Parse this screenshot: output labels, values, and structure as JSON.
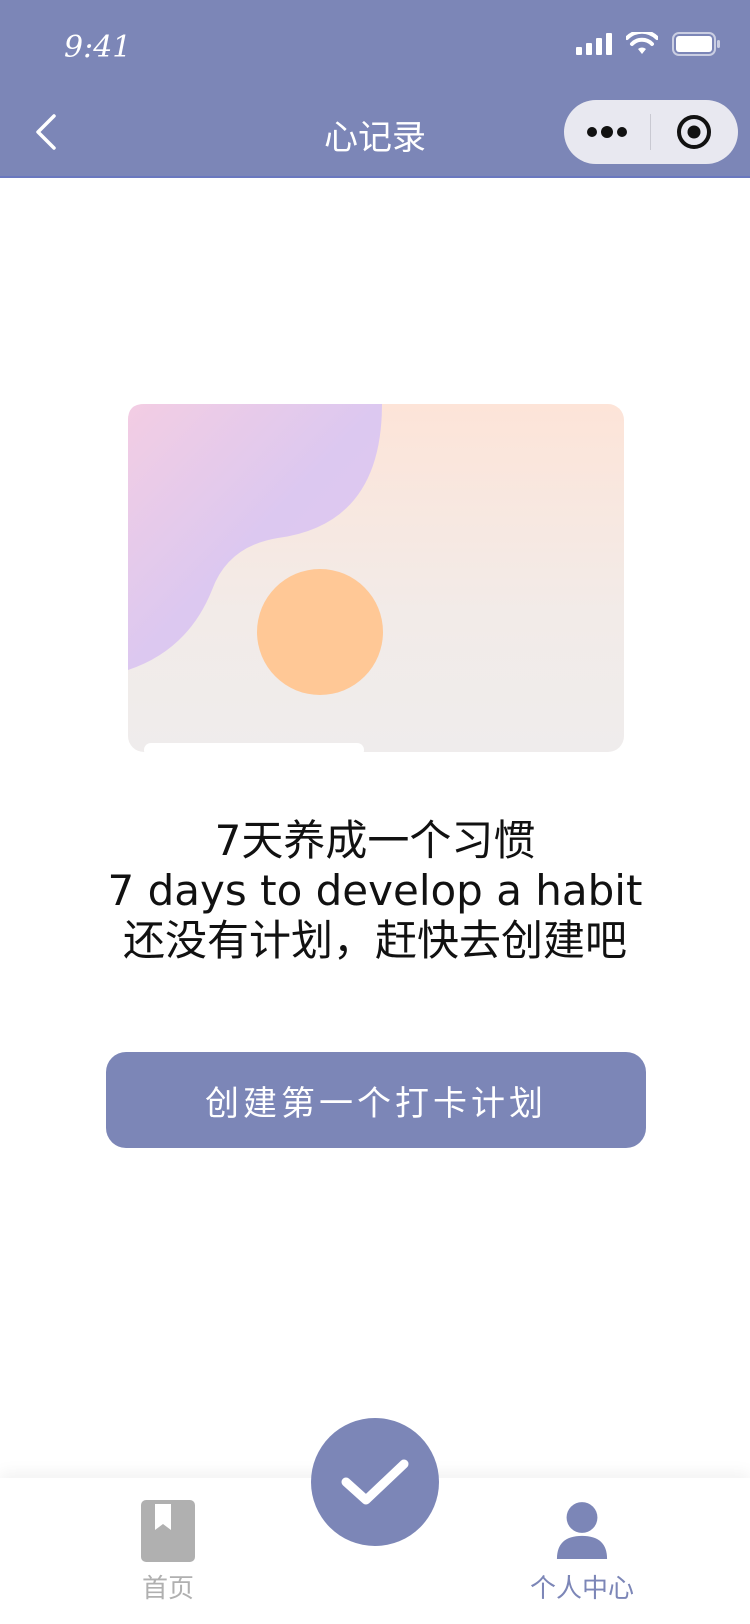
{
  "status_bar": {
    "time": "9:41",
    "icons": [
      "signal-icon",
      "wifi-icon",
      "battery-icon"
    ]
  },
  "nav": {
    "title": "心记录",
    "back_icon": "chevron-left-icon",
    "capsule_more_icon": "more-dots-icon",
    "capsule_close_icon": "target-circle-icon"
  },
  "empty_state": {
    "line1": "7天养成一个习惯",
    "line2": "7 days to develop a habit",
    "line3": "还没有计划，赶快去创建吧"
  },
  "create_button": {
    "label": "创建第一个打卡计划"
  },
  "tabbar": {
    "home_label": "首页",
    "home_icon": "bookmark-book-icon",
    "center_icon": "checkmark-icon",
    "profile_label": "个人中心",
    "profile_icon": "user-icon"
  },
  "colors": {
    "primary": "#7c86b7",
    "header_bg": "#7c86b7",
    "tab_inactive": "#b0b0b0",
    "illustration_orange": "#ffc896",
    "illustration_purple": "#dcc8f0"
  }
}
